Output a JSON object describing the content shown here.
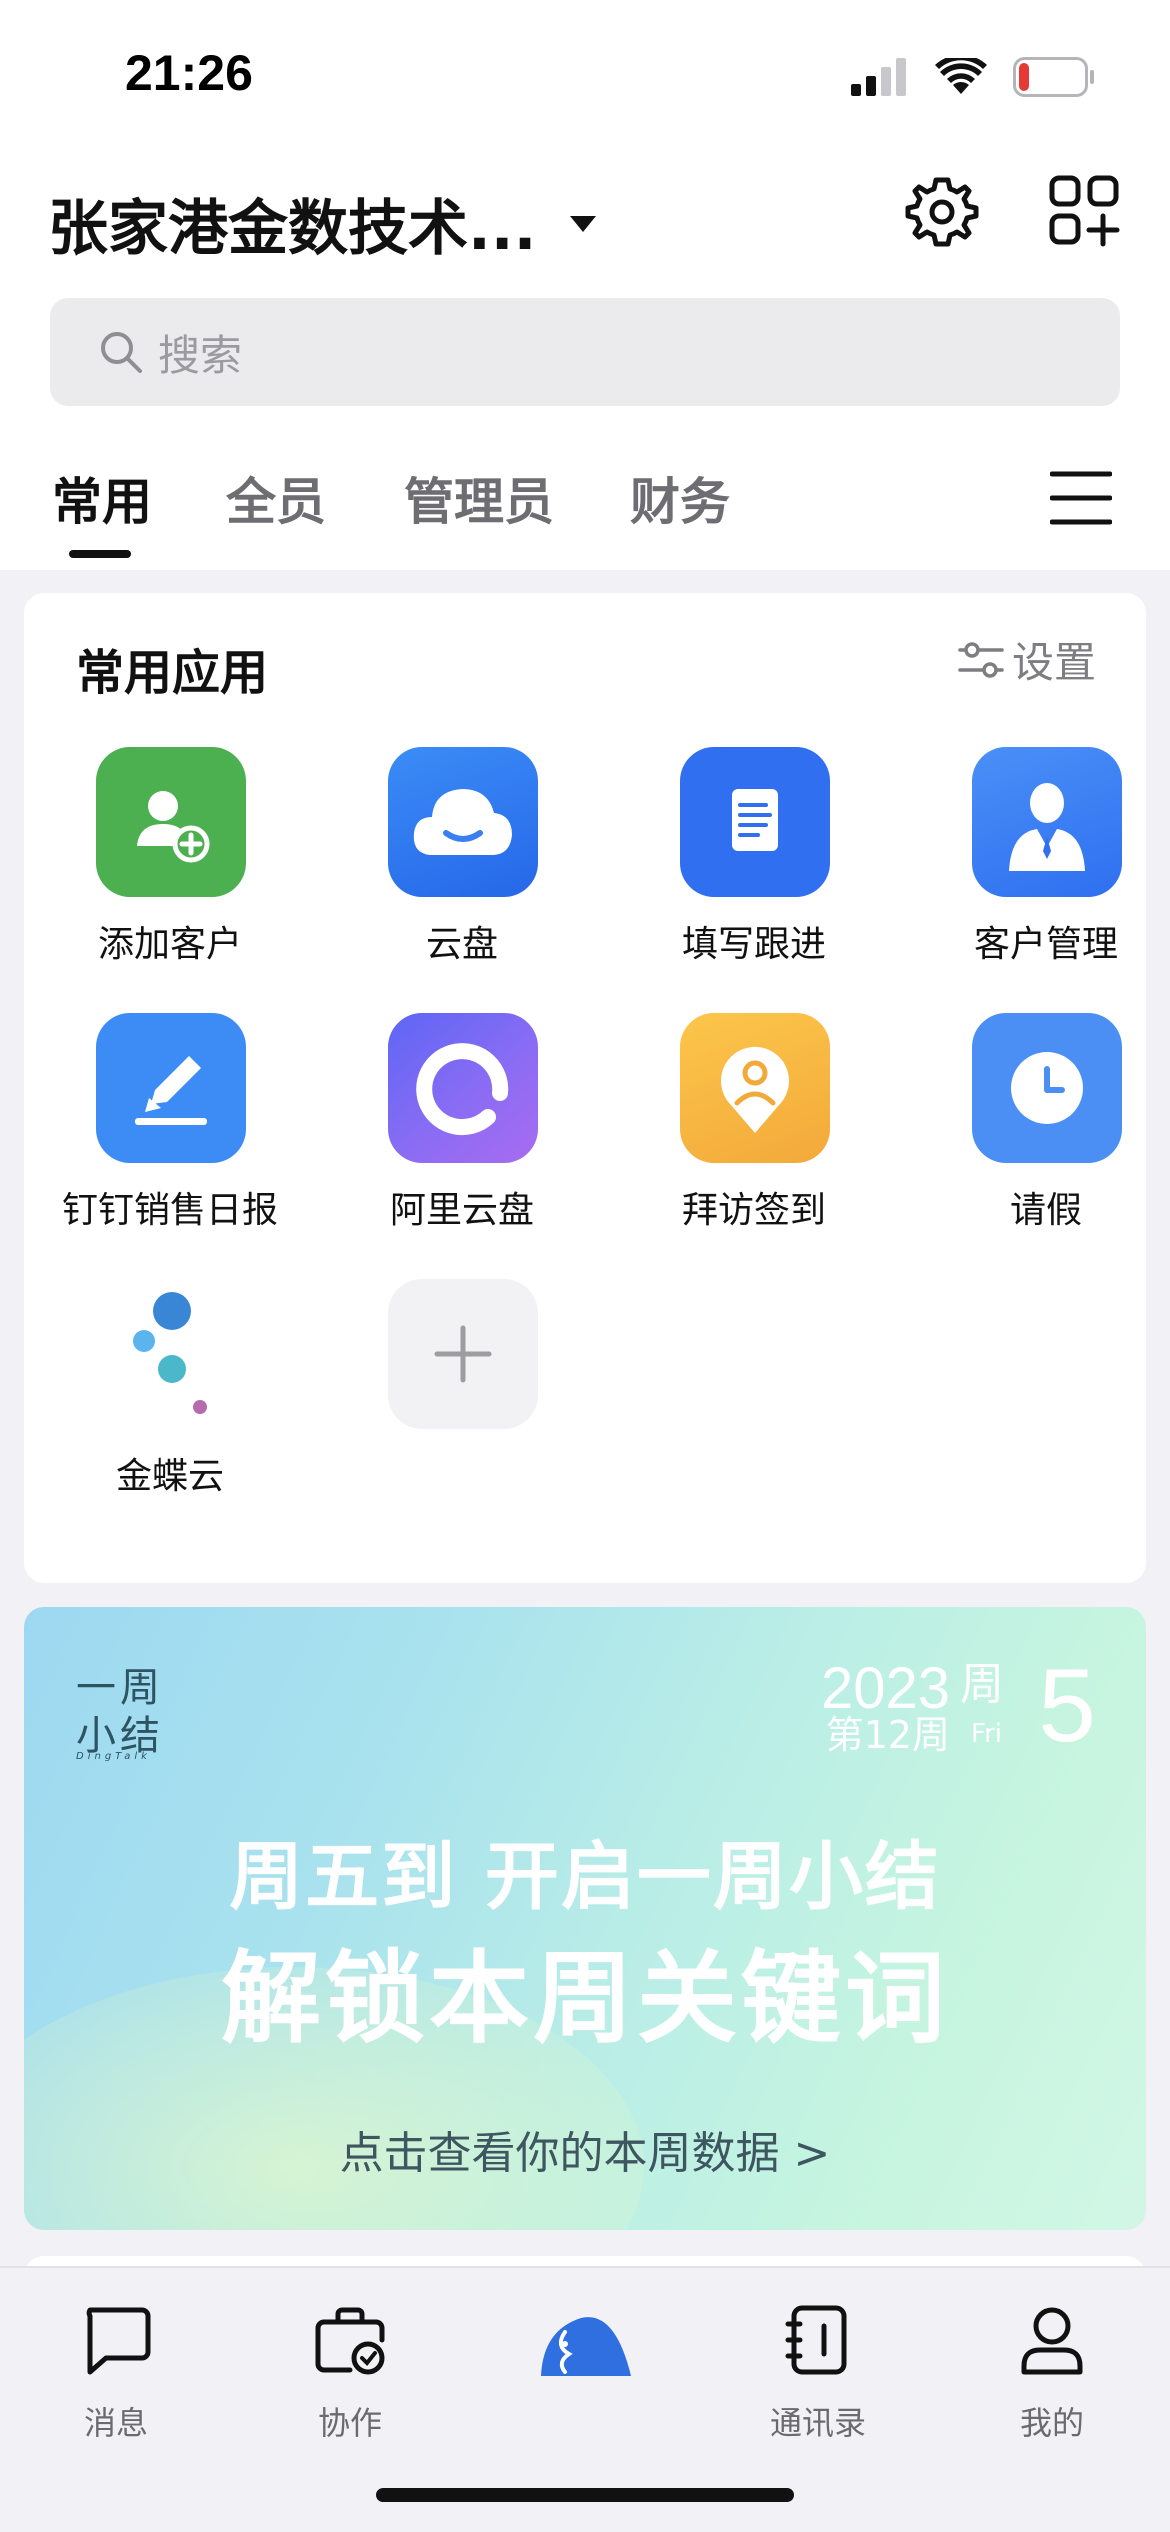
{
  "status_bar": {
    "time": "21:26",
    "battery_level": 0.15,
    "battery_color": "#e53935"
  },
  "header": {
    "org_name": "张家港金数技术...",
    "search_placeholder": "搜索"
  },
  "tabs": [
    {
      "label": "常用",
      "active": true
    },
    {
      "label": "全员",
      "active": false
    },
    {
      "label": "管理员",
      "active": false
    },
    {
      "label": "财务",
      "active": false
    }
  ],
  "common_apps": {
    "title": "常用应用",
    "setting_label": "设置",
    "apps": [
      {
        "label": "添加客户",
        "icon": "add-customer-icon",
        "color": "#4caf50"
      },
      {
        "label": "云盘",
        "icon": "cloud-drive-icon",
        "color": "#2f7bf5"
      },
      {
        "label": "填写跟进",
        "icon": "follow-up-doc-icon",
        "color": "#2f6ff0"
      },
      {
        "label": "客户管理",
        "icon": "customer-management-icon",
        "color": "#3b82f6"
      },
      {
        "label": "钉钉销售日报",
        "icon": "pencil-icon",
        "color": "#3d8cf5"
      },
      {
        "label": "阿里云盘",
        "icon": "aliyun-drive-icon",
        "color": "#6b6cf6"
      },
      {
        "label": "拜访签到",
        "icon": "visit-checkin-icon",
        "color": "#f6b93b"
      },
      {
        "label": "请假",
        "icon": "clock-icon",
        "color": "#4c8ff4"
      },
      {
        "label": "金蝶云",
        "icon": "kingdee-cloud-icon",
        "color": "#3a86d6"
      }
    ],
    "add_app_icon": "plus-icon"
  },
  "banner": {
    "logo_line1": "一周",
    "logo_line2": "小结",
    "logo_sub": "DingTalk",
    "year": "2023",
    "week": "第12周",
    "weekday_cn": "周",
    "weekday_en": "Fri",
    "weekday_num": "5",
    "line1": "周五到 开启一周小结",
    "line2": "解锁本周关键词",
    "cta": "点击查看你的本周数据 >"
  },
  "bottom_nav": [
    {
      "label": "消息",
      "icon": "message-icon"
    },
    {
      "label": "协作",
      "icon": "collaboration-icon"
    },
    {
      "label": "",
      "icon": "dingtalk-logo-icon"
    },
    {
      "label": "通讯录",
      "icon": "contacts-icon"
    },
    {
      "label": "我的",
      "icon": "profile-icon"
    }
  ]
}
